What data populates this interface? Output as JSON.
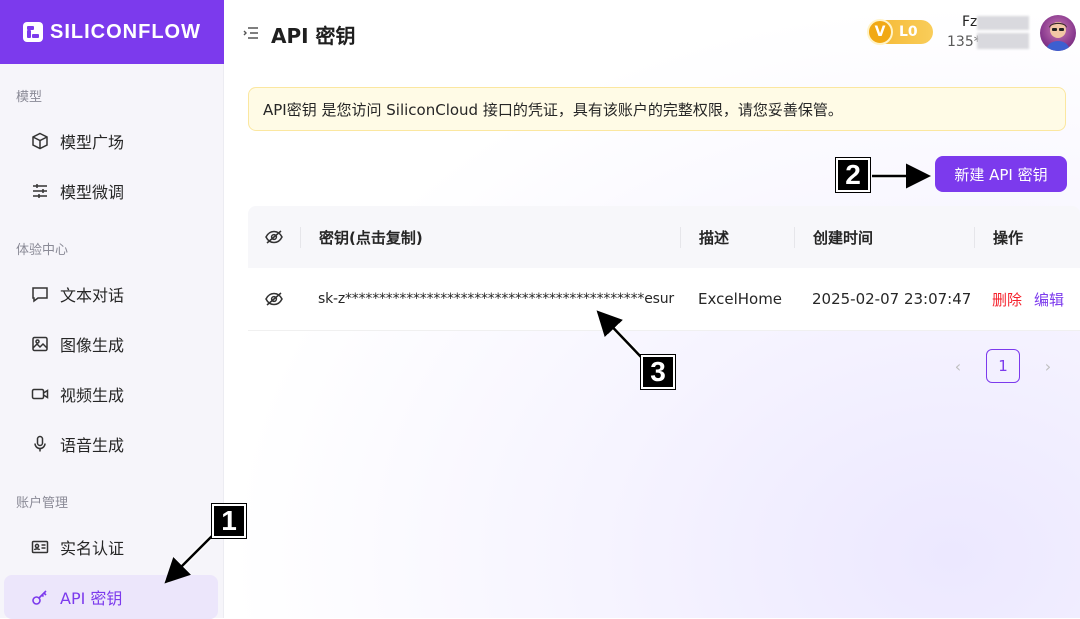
{
  "brand": {
    "name": "SILICONFLOW"
  },
  "sidebar": {
    "sections": [
      {
        "label": "模型"
      },
      {
        "label": "体验中心"
      },
      {
        "label": "账户管理"
      }
    ],
    "items": [
      {
        "label": "模型广场",
        "icon": "cube-icon"
      },
      {
        "label": "模型微调",
        "icon": "sliders-icon"
      },
      {
        "label": "文本对话",
        "icon": "chat-icon"
      },
      {
        "label": "图像生成",
        "icon": "image-icon"
      },
      {
        "label": "视频生成",
        "icon": "video-icon"
      },
      {
        "label": "语音生成",
        "icon": "microphone-icon"
      },
      {
        "label": "实名认证",
        "icon": "id-card-icon"
      },
      {
        "label": "API 密钥",
        "icon": "key-icon",
        "active": true
      }
    ]
  },
  "header": {
    "title": "API 密钥",
    "level_badge_letter": "V",
    "level": "L0",
    "user_name": "Fz",
    "user_phone": "135*"
  },
  "notice": {
    "text": "API密钥 是您访问 SiliconCloud 接口的凭证，具有该账户的完整权限，请您妥善保管。"
  },
  "new_key_button": {
    "label": "新建 API 密钥"
  },
  "table": {
    "columns": [
      "密钥(点击复制)",
      "描述",
      "创建时间",
      "操作"
    ],
    "rows": [
      {
        "key": "sk-z********************************************esur",
        "description": "ExcelHome",
        "created": "2025-02-07 23:07:47",
        "delete_label": "删除",
        "edit_label": "编辑"
      }
    ]
  },
  "pagination": {
    "prev": "‹",
    "current": "1",
    "next": "›"
  },
  "annotations": [
    {
      "number": "1"
    },
    {
      "number": "2"
    },
    {
      "number": "3"
    }
  ],
  "colors": {
    "accent": "#7c3aed",
    "danger": "#f5222d",
    "notice_bg": "#fffbe6",
    "badge": "#f5b731"
  }
}
